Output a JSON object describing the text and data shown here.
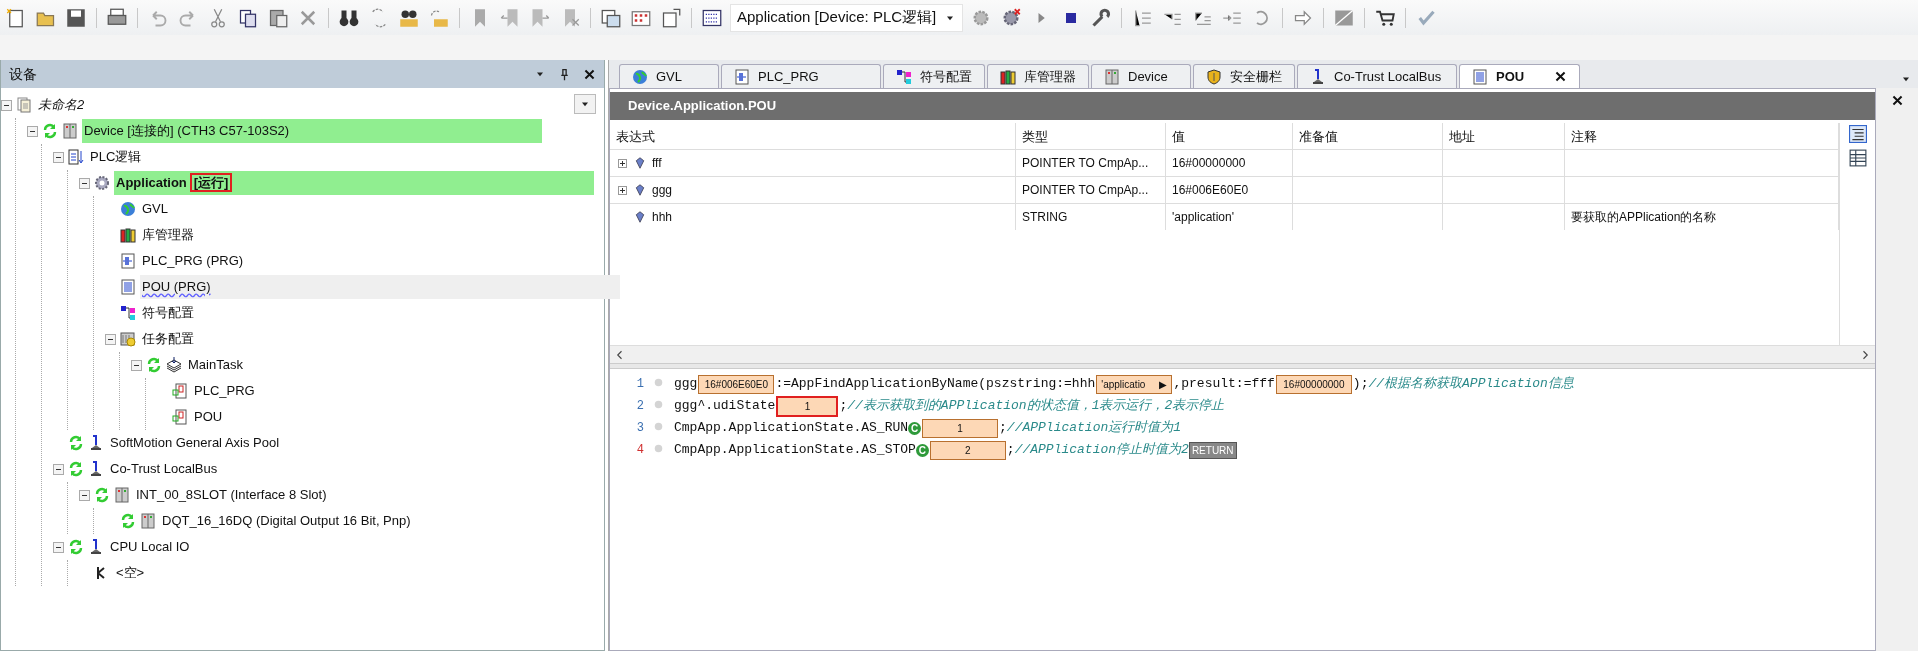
{
  "toolbar": {
    "app_selector": "Application [Device: PLC逻辑]"
  },
  "devices_panel": {
    "title": "设备",
    "tree": [
      {
        "label": "未命名2",
        "kind": "project",
        "connected": false,
        "highlighted": false,
        "selected": false,
        "expanded": true,
        "children": [
          {
            "label": "Device [连接的] (CTH3 C57-103S2)",
            "kind": "device",
            "connected": true,
            "highlighted": true,
            "selected": false,
            "expanded": true,
            "children": [
              {
                "label": "PLC逻辑",
                "kind": "logic",
                "connected": false,
                "highlighted": false,
                "selected": false,
                "expanded": true,
                "children": [
                  {
                    "label": "Application",
                    "status": "[运行]",
                    "kind": "application",
                    "connected": false,
                    "highlighted": true,
                    "selected": false,
                    "expanded": true,
                    "children": [
                      {
                        "label": "GVL",
                        "kind": "gvl",
                        "connected": false,
                        "highlighted": false,
                        "selected": false
                      },
                      {
                        "label": "库管理器",
                        "kind": "library",
                        "connected": false,
                        "highlighted": false,
                        "selected": false
                      },
                      {
                        "label": "PLC_PRG (PRG)",
                        "kind": "program",
                        "connected": false,
                        "highlighted": false,
                        "selected": false
                      },
                      {
                        "label": "POU (PRG)",
                        "kind": "pou",
                        "connected": false,
                        "highlighted": false,
                        "selected": true
                      },
                      {
                        "label": "符号配置",
                        "kind": "symbol",
                        "connected": false,
                        "highlighted": false,
                        "selected": false
                      },
                      {
                        "label": "任务配置",
                        "kind": "taskconfig",
                        "connected": false,
                        "highlighted": false,
                        "selected": false,
                        "expanded": true,
                        "children": [
                          {
                            "label": "MainTask",
                            "kind": "task",
                            "connected": true,
                            "highlighted": false,
                            "selected": false,
                            "expanded": true,
                            "children": [
                              {
                                "label": "PLC_PRG",
                                "kind": "taskref",
                                "connected": false,
                                "highlighted": false,
                                "selected": false
                              },
                              {
                                "label": "POU",
                                "kind": "taskref",
                                "connected": false,
                                "highlighted": false,
                                "selected": false
                              }
                            ]
                          }
                        ]
                      }
                    ]
                  }
                ]
              },
              {
                "label": "SoftMotion General Axis Pool",
                "kind": "connector",
                "connected": true,
                "highlighted": false,
                "selected": false
              },
              {
                "label": "Co-Trust LocalBus",
                "kind": "connector",
                "connected": true,
                "highlighted": false,
                "selected": false,
                "expanded": true,
                "children": [
                  {
                    "label": "INT_00_8SLOT (Interface 8 Slot)",
                    "kind": "device",
                    "connected": true,
                    "highlighted": false,
                    "selected": false,
                    "expanded": true,
                    "children": [
                      {
                        "label": "DQT_16_16DQ (Digital Output 16 Bit, Pnp)",
                        "kind": "device",
                        "connected": true,
                        "highlighted": false,
                        "selected": false
                      }
                    ]
                  }
                ]
              },
              {
                "label": "CPU Local IO",
                "kind": "connector",
                "connected": true,
                "highlighted": false,
                "selected": false,
                "expanded": true,
                "children": [
                  {
                    "label": "<空>",
                    "kind": "slot",
                    "connected": false,
                    "highlighted": false,
                    "selected": false
                  }
                ]
              }
            ]
          }
        ]
      }
    ]
  },
  "editor_tabs": [
    {
      "label": "GVL",
      "kind": "gvl",
      "selected": false,
      "closable": false
    },
    {
      "label": "PLC_PRG",
      "kind": "program",
      "selected": false,
      "closable": false
    },
    {
      "label": "符号配置",
      "kind": "symbol",
      "selected": false,
      "closable": false
    },
    {
      "label": "库管理器",
      "kind": "library",
      "selected": false,
      "closable": false
    },
    {
      "label": "Device",
      "kind": "device",
      "selected": false,
      "closable": false
    },
    {
      "label": "安全栅栏",
      "kind": "shield",
      "selected": false,
      "closable": false
    },
    {
      "label": "Co-Trust LocalBus",
      "kind": "connector",
      "selected": false,
      "closable": false
    },
    {
      "label": "POU",
      "kind": "pou",
      "selected": true,
      "closable": true
    }
  ],
  "watch_table": {
    "title": "Device.Application.POU",
    "columns": [
      "表达式",
      "类型",
      "值",
      "准备值",
      "地址",
      "注释"
    ],
    "rows": [
      {
        "expandable": true,
        "cells": [
          "fff",
          "POINTER TO CmpAp...",
          "16#00000000",
          "",
          "",
          ""
        ]
      },
      {
        "expandable": true,
        "cells": [
          "ggg",
          "POINTER TO CmpAp...",
          "16#006E60E0",
          "",
          "",
          ""
        ]
      },
      {
        "expandable": false,
        "cells": [
          "hhh",
          "STRING",
          "'application'",
          "",
          "",
          "要获取的APPlication的名称"
        ]
      }
    ]
  },
  "code_lines": [
    {
      "number": "1",
      "color": "#3a6fb0",
      "tokens": [
        {
          "kind": "code",
          "text": "ggg"
        },
        {
          "kind": "value",
          "text": "16#006E60E0",
          "boxed": false
        },
        {
          "kind": "code",
          "text": ":=AppFindApplicationByName(pszstring:=hhh"
        },
        {
          "kind": "value",
          "text": "'applicatio",
          "more": "▶",
          "boxed": false
        },
        {
          "kind": "code",
          "text": ",presult:=fff"
        },
        {
          "kind": "value",
          "text": "16#00000000",
          "boxed": false
        },
        {
          "kind": "code",
          "text": ");"
        },
        {
          "kind": "comment",
          "text": "//根据名称获取APPlication信息"
        }
      ]
    },
    {
      "number": "2",
      "color": "#3a6fb0",
      "tokens": [
        {
          "kind": "code",
          "text": "ggg^.udiState"
        },
        {
          "kind": "value",
          "text": "1",
          "boxed": true
        },
        {
          "kind": "code",
          "text": ";"
        },
        {
          "kind": "comment",
          "text": "//表示获取到的APPlication的状态值，1表示运行，2表示停止"
        }
      ]
    },
    {
      "number": "3",
      "color": "#3a6fb0",
      "tokens": [
        {
          "kind": "code",
          "text": "CmpApp.ApplicationState.AS_RUN"
        },
        {
          "kind": "const",
          "text": "C"
        },
        {
          "kind": "value",
          "text": "1",
          "boxed": false
        },
        {
          "kind": "code",
          "text": ";"
        },
        {
          "kind": "comment",
          "text": "//APPlication运行时值为1"
        }
      ]
    },
    {
      "number": "4",
      "color": "#d03030",
      "tokens": [
        {
          "kind": "code",
          "text": "CmpApp.ApplicationState.AS_STOP"
        },
        {
          "kind": "const",
          "text": "C"
        },
        {
          "kind": "value",
          "text": "2",
          "boxed": false
        },
        {
          "kind": "code",
          "text": ";"
        },
        {
          "kind": "comment",
          "text": "//APPlication停止时值为2"
        },
        {
          "kind": "return",
          "text": "RETURN"
        }
      ]
    }
  ]
}
